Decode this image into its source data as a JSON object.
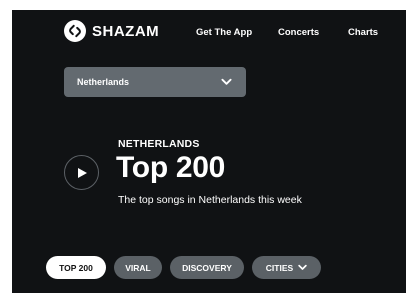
{
  "header": {
    "brand": "SHAZAM",
    "nav": [
      {
        "label": "Get The App"
      },
      {
        "label": "Concerts"
      },
      {
        "label": "Charts"
      }
    ]
  },
  "country_select": {
    "value": "Netherlands",
    "icon": "chevron-down-icon"
  },
  "hero": {
    "eyebrow": "NETHERLANDS",
    "title": "Top 200",
    "subtitle": "The top songs in Netherlands this week",
    "play_icon": "play-icon"
  },
  "filters": [
    {
      "label": "TOP 200",
      "active": true
    },
    {
      "label": "VIRAL",
      "active": false
    },
    {
      "label": "DISCOVERY",
      "active": false
    },
    {
      "label": "CITIES",
      "active": false
    }
  ],
  "colors": {
    "background": "#101214",
    "dropdown": "#636a70",
    "chip": "#5b6166",
    "chip_active": "#ffffff",
    "text": "#ffffff"
  }
}
